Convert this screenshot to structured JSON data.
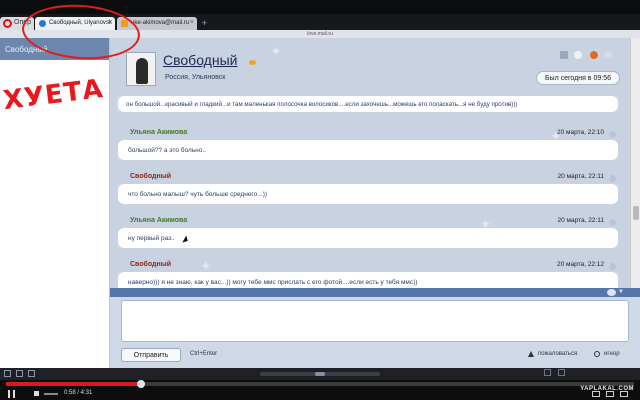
{
  "browser": {
    "opera_label": "Опер",
    "tabs": [
      {
        "label": "Свободный, Ulyanovsk",
        "close": "×"
      },
      {
        "label": "uke-akimova@mail.ru",
        "close": "×"
      }
    ],
    "new_tab": "+",
    "url": "love.mail.ru"
  },
  "sidebar": {
    "header": "Свободный"
  },
  "scrawl": "ХУЕТА",
  "profile": {
    "name": "Свободный",
    "location": "Россия, Ульяновск",
    "last_seen": "Был сегодня в 09:56"
  },
  "messages": {
    "first_partial": "он большой...красивый и гладкий...и там маленькая полосочка волосиков....если захочешь...можешь его поласкать...я не буду против)))",
    "items": [
      {
        "author": "Ульяна Акимова",
        "time": "20 марта, 22:10",
        "text": "большой?? а это больно.."
      },
      {
        "author": "Свободный",
        "time": "20 марта, 22:11",
        "text": "что больно малыш? чуть больше среднего...))"
      },
      {
        "author": "Ульяна Акимова",
        "time": "20 марта, 22:11",
        "text": "ну первый раз.."
      },
      {
        "author": "Свободный",
        "time": "20 марта, 22:12",
        "text": "наверно))) я не знаю, как у вас...)) могу тебе ммс прислать с его фотой....если есть у тебя ммс))"
      }
    ]
  },
  "compose": {
    "send_label": "Отправить",
    "hint": "Ctrl+Enter",
    "complain": "пожаловаться",
    "ignore": "игнор"
  },
  "player": {
    "time": "0:58 / 4:31",
    "watermark": "YAPLAKAL.COM",
    "progress": 0.215
  },
  "colors": {
    "accent_red": "#d11d1d",
    "panel_bg": "#c9d2e1",
    "sidebar_header": "#6c86ad",
    "author_green": "#3f7a2c",
    "author_brown": "#8a2a1a"
  }
}
